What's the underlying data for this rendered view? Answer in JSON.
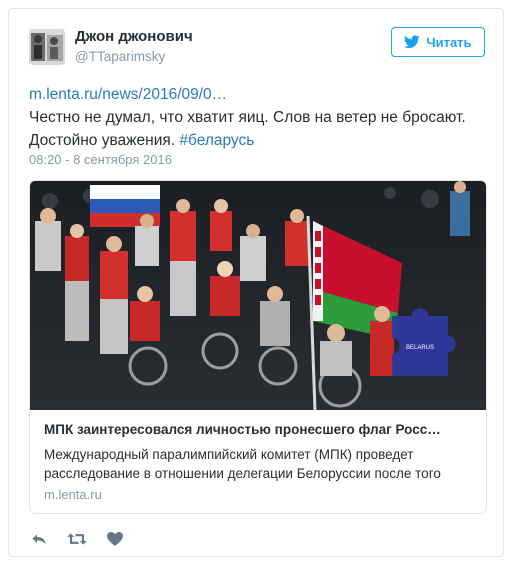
{
  "author": {
    "name": "Джон джонович",
    "handle": "@TTaparimsky"
  },
  "follow_button": {
    "label": "Читать",
    "icon": "twitter-bird-icon"
  },
  "tweet": {
    "link": "m.lenta.ru/news/2016/09/0…",
    "text": "Честно не думал, что хватит яиц. Слов на ветер не бросают. Достойно уважения.",
    "hashtag": "#беларусь",
    "timestamp": "08:20 - 8 сентября 2016"
  },
  "card": {
    "image_badge": "BELARUS",
    "title": "МПК заинтересовался личностью пронесшего флаг Росс…",
    "description": "Международный паралимпийский комитет (МПК) проведет расследование в отношении делегации Белоруссии после того",
    "domain": "m.lenta.ru"
  },
  "actions": [
    {
      "name": "reply",
      "icon": "reply-icon"
    },
    {
      "name": "retweet",
      "icon": "retweet-icon"
    },
    {
      "name": "like",
      "icon": "heart-icon"
    }
  ],
  "colors": {
    "accent": "#1da1f2",
    "link": "#2b7bb9",
    "muted": "#8899a6",
    "text": "#292f33",
    "border": "#e1e8ed",
    "action_icon": "#657786"
  }
}
